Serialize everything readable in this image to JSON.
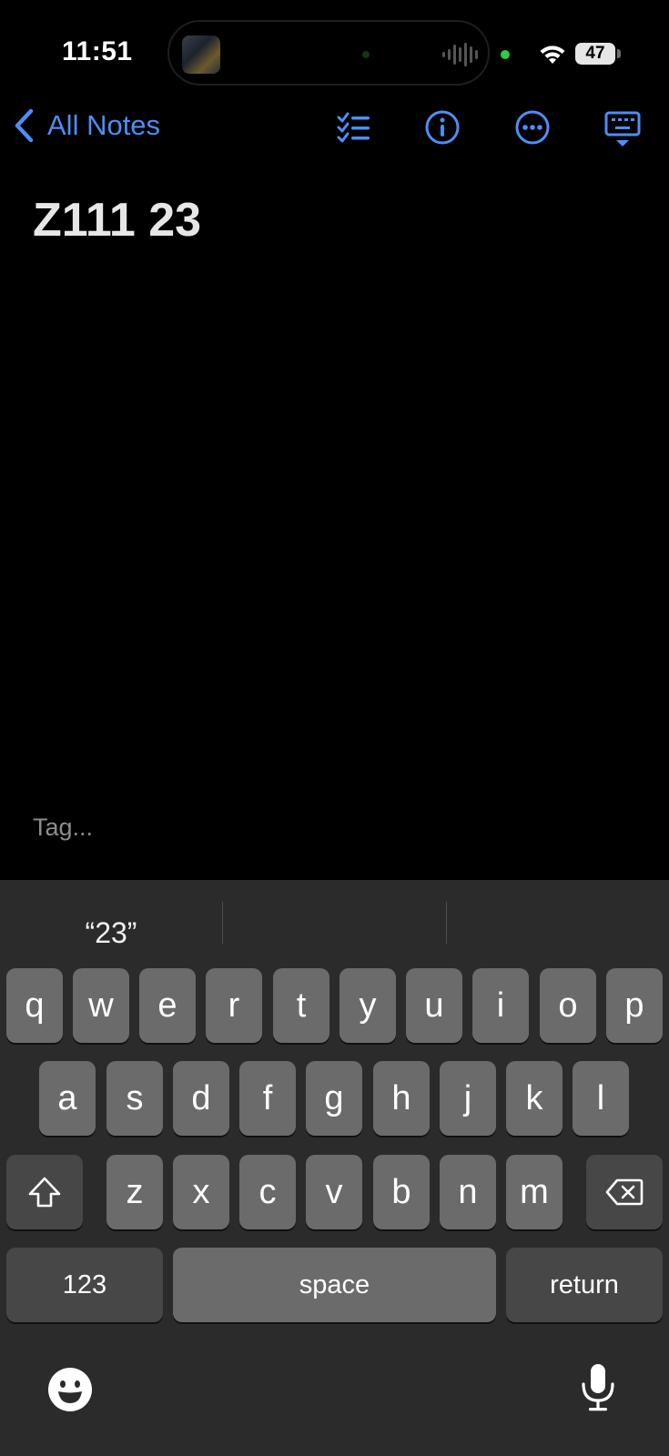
{
  "status": {
    "time": "11:51",
    "battery": "47"
  },
  "nav": {
    "back_label": "All Notes",
    "icons": [
      "checklist-icon",
      "info-icon",
      "more-icon",
      "keyboard-dismiss-icon"
    ],
    "accent_color": "#4d8ef7"
  },
  "note": {
    "title": "Z111 23",
    "tag_placeholder": "Tag..."
  },
  "keyboard": {
    "suggestions": [
      "“23”",
      "",
      ""
    ],
    "row1": [
      "q",
      "w",
      "e",
      "r",
      "t",
      "y",
      "u",
      "i",
      "o",
      "p"
    ],
    "row2": [
      "a",
      "s",
      "d",
      "f",
      "g",
      "h",
      "j",
      "k",
      "l"
    ],
    "row3": [
      "z",
      "x",
      "c",
      "v",
      "b",
      "n",
      "m"
    ],
    "numbers_label": "123",
    "space_label": "space",
    "return_label": "return"
  }
}
